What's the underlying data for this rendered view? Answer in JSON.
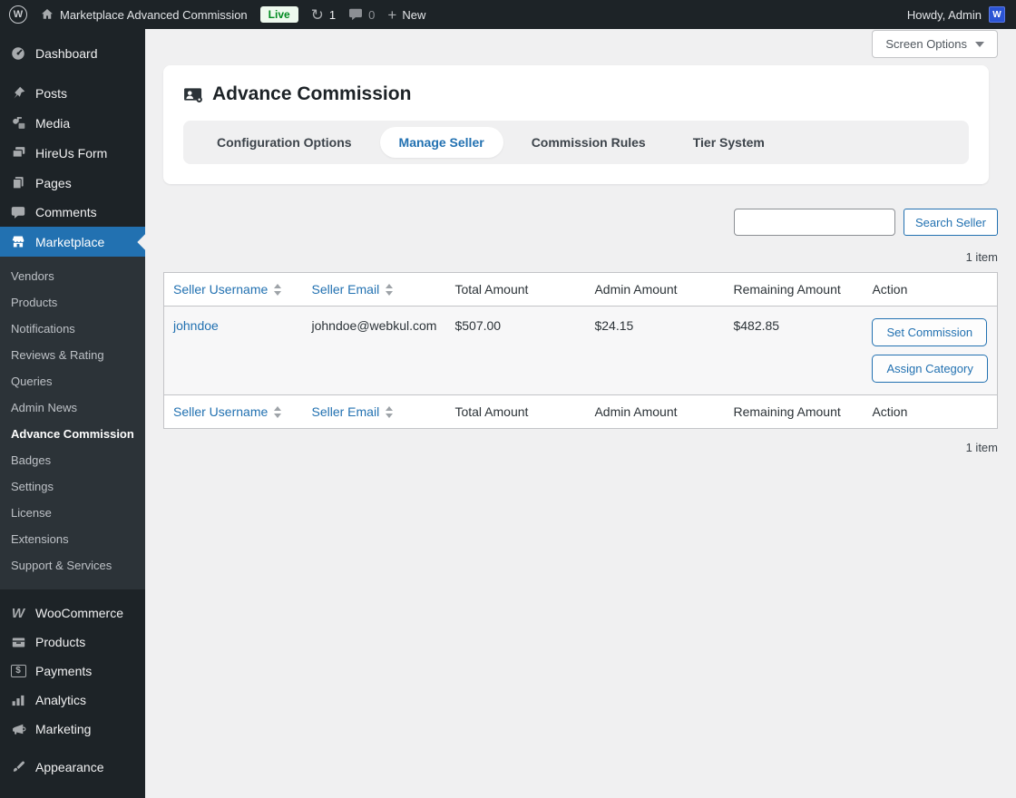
{
  "admin_bar": {
    "site_name": "Marketplace Advanced Commission",
    "live_badge": "Live",
    "updates_count": "1",
    "comments_count": "0",
    "new_label": "New",
    "howdy_text": "Howdy, Admin",
    "avatar_letter": "W",
    "wp_logo_letter": "W"
  },
  "sidebar": {
    "items": [
      {
        "label": "Dashboard"
      },
      {
        "label": "Posts"
      },
      {
        "label": "Media"
      },
      {
        "label": "HireUs Form"
      },
      {
        "label": "Pages"
      },
      {
        "label": "Comments"
      },
      {
        "label": "Marketplace"
      }
    ],
    "marketplace_submenu": [
      "Vendors",
      "Products",
      "Notifications",
      "Reviews & Rating",
      "Queries",
      "Admin News",
      "Advance Commission",
      "Badges",
      "Settings",
      "License",
      "Extensions",
      "Support & Services"
    ],
    "current_submenu_item": "Advance Commission",
    "lower_items": [
      {
        "label": "WooCommerce",
        "logo_letter": "W"
      },
      {
        "label": "Products"
      },
      {
        "label": "Payments",
        "badge_char": "$"
      },
      {
        "label": "Analytics"
      },
      {
        "label": "Marketing"
      },
      {
        "label": "Appearance"
      }
    ]
  },
  "screen_options": {
    "label": "Screen Options"
  },
  "page": {
    "title": "Advance Commission",
    "tabs": [
      {
        "label": "Configuration Options",
        "active": false
      },
      {
        "label": "Manage Seller",
        "active": true
      },
      {
        "label": "Commission Rules",
        "active": false
      },
      {
        "label": "Tier System",
        "active": false
      }
    ]
  },
  "search": {
    "value": "",
    "button_label": "Search Seller"
  },
  "list": {
    "count_text": "1 item",
    "footer_count_text": "1 item",
    "columns": [
      {
        "label": "Seller Username",
        "sortable": true
      },
      {
        "label": "Seller Email",
        "sortable": true
      },
      {
        "label": "Total Amount",
        "sortable": false
      },
      {
        "label": "Admin Amount",
        "sortable": false
      },
      {
        "label": "Remaining Amount",
        "sortable": false
      },
      {
        "label": "Action",
        "sortable": false
      }
    ],
    "rows": [
      {
        "username": "johndoe",
        "email": "johndoe@webkul.com",
        "total_amount": "$507.00",
        "admin_amount": "$24.15",
        "remaining_amount": "$482.85",
        "actions": {
          "set_commission": "Set Commission",
          "assign_category": "Assign Category"
        }
      }
    ]
  },
  "colors": {
    "accent": "#2271b1",
    "admin_bar_bg": "#1d2327",
    "submenu_bg": "#2c3338",
    "content_bg": "#f0f0f1",
    "live_badge_bg": "#eef9ee",
    "live_badge_text": "#008a20"
  },
  "icons": {
    "wordpress_logo": "W in circle",
    "home_icon": "house",
    "updates_icon": "↻",
    "comments_icon": "speech bubble",
    "new_icon": "+",
    "screen_options_caret": "▾"
  }
}
